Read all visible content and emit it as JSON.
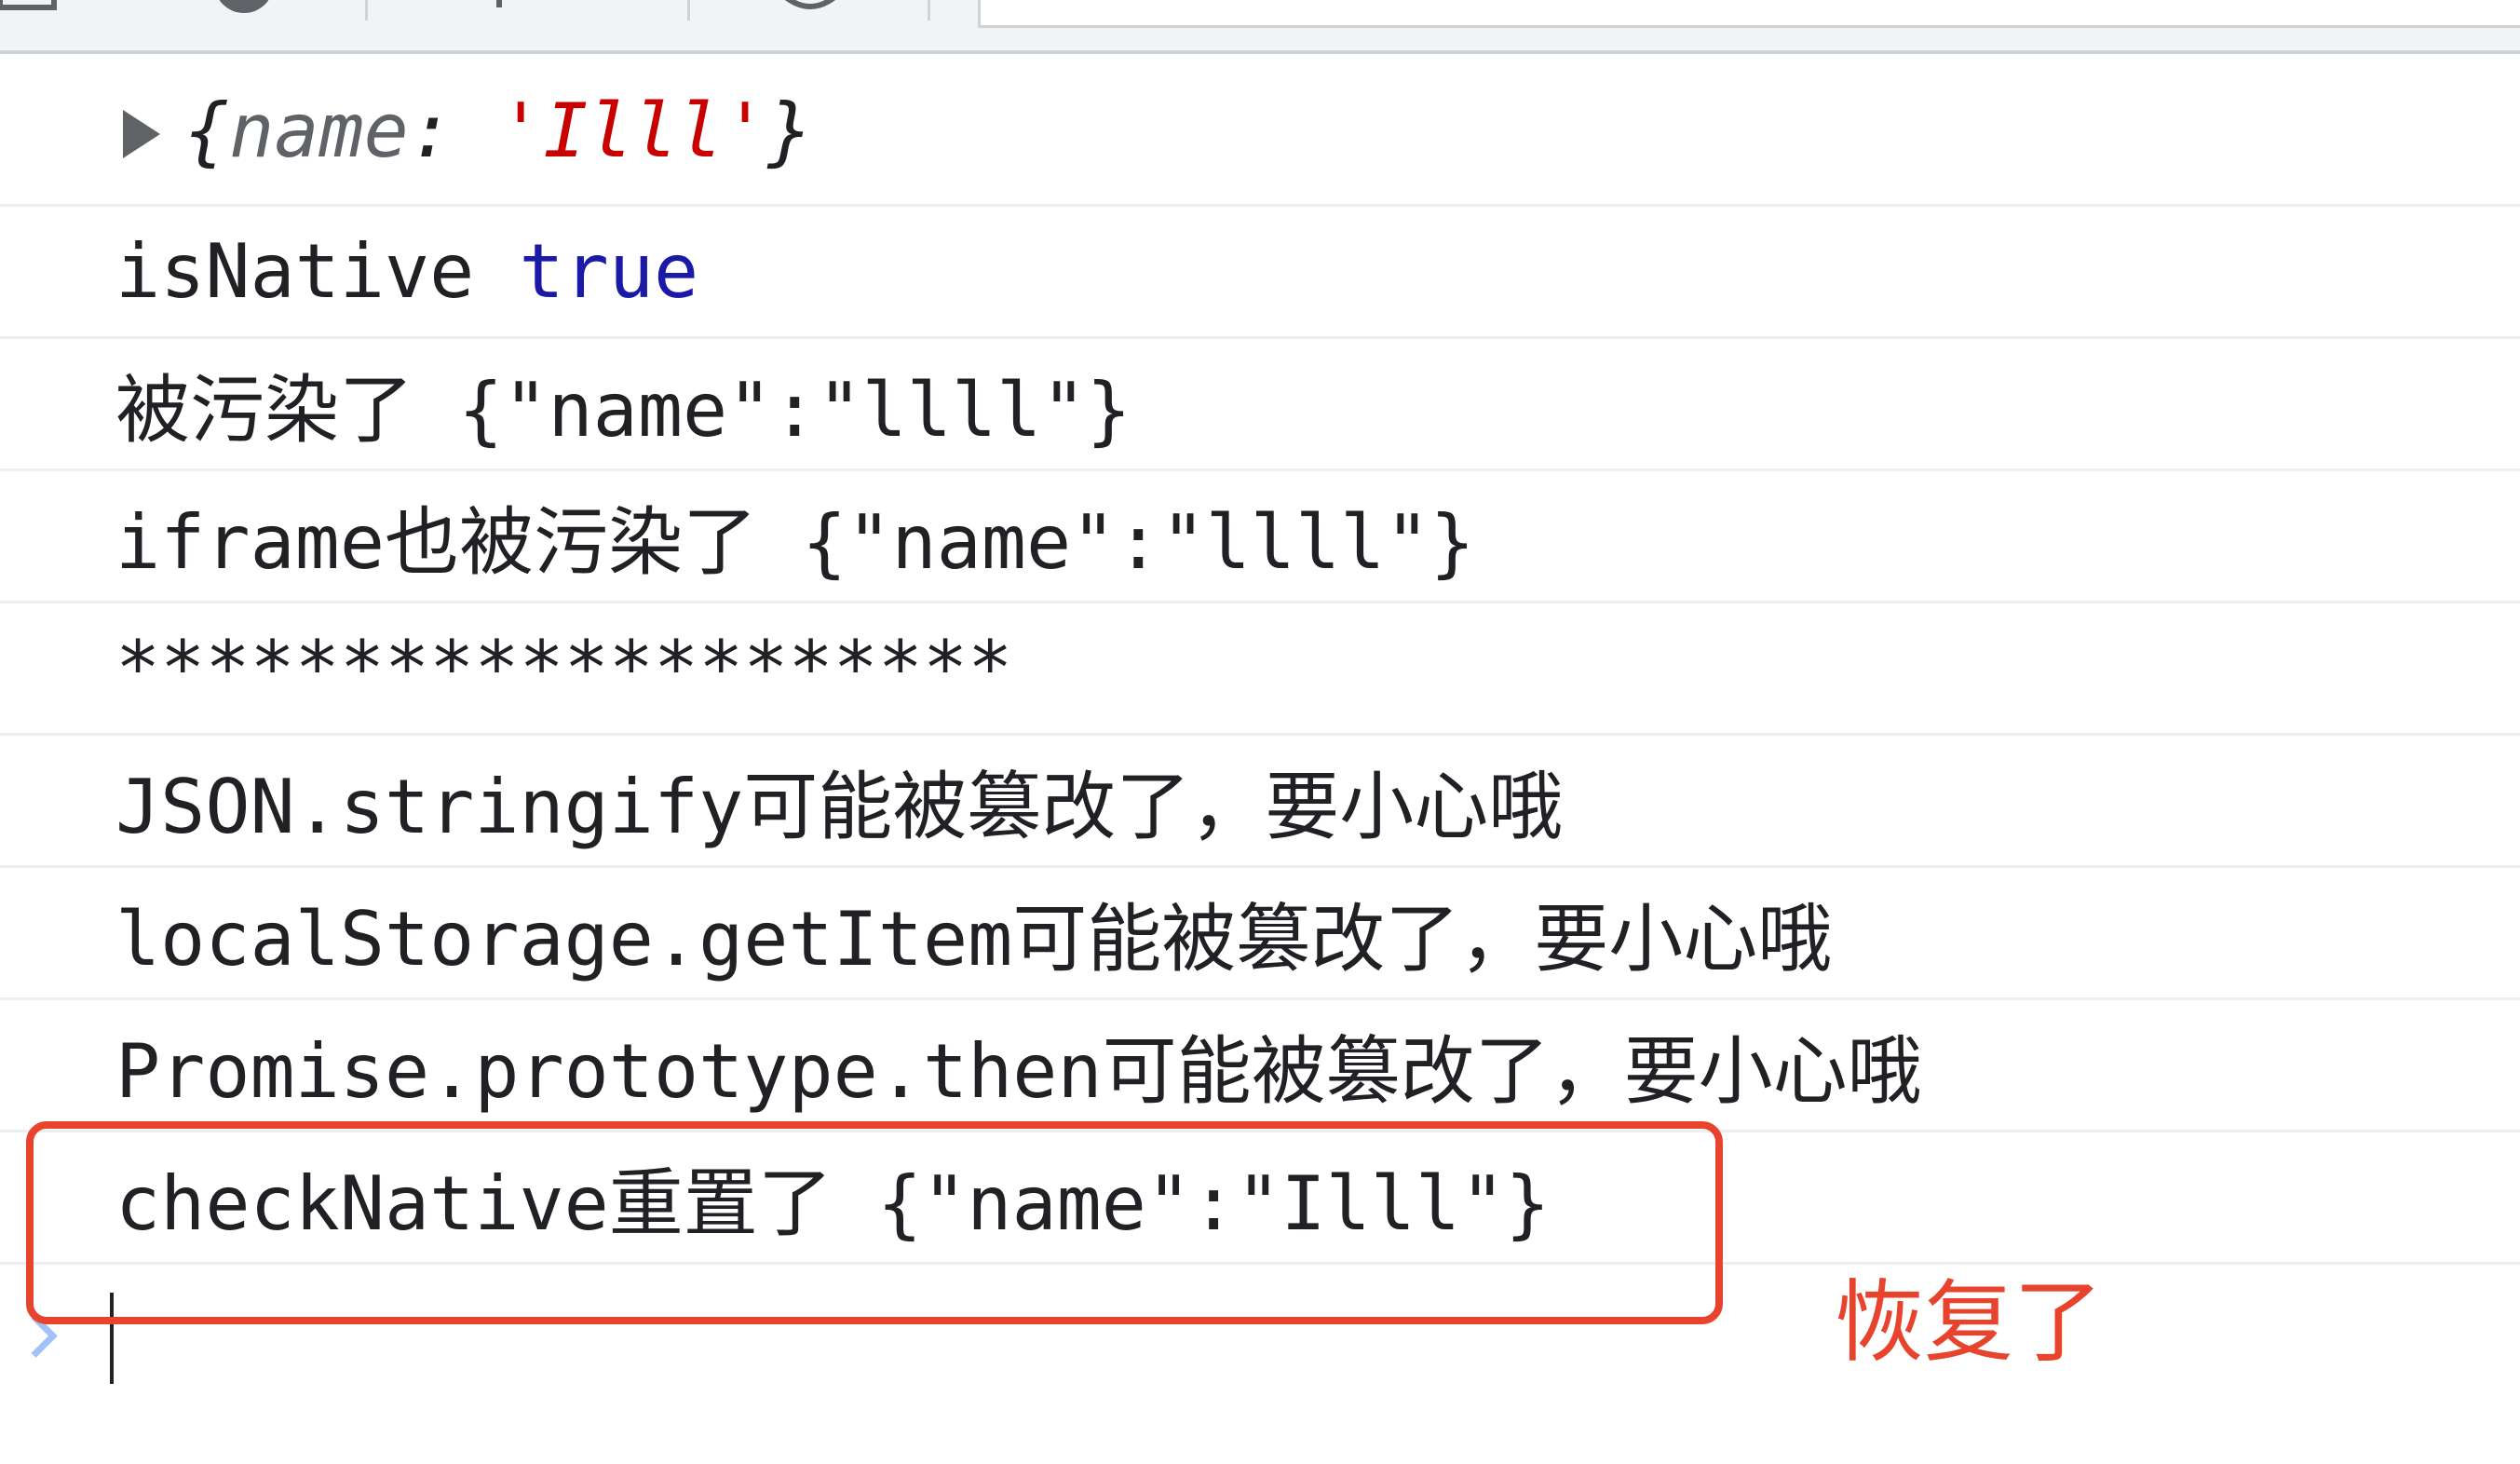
{
  "toolbar": {
    "icons": [
      "clear-console-icon",
      "block-icon",
      "context-dropdown-icon",
      "eye-icon"
    ],
    "filter_placeholder": ""
  },
  "console": {
    "rows": [
      {
        "kind": "object",
        "open": "{",
        "key": "name",
        "sep": ": ",
        "value": "'Illl'",
        "close": "}"
      },
      {
        "kind": "text",
        "label": "isNative",
        "value": "true"
      },
      {
        "kind": "text",
        "text": "被污染了 {\"name\":\"llll\"}"
      },
      {
        "kind": "text",
        "text": "iframe也被污染了 {\"name\":\"llll\"}"
      },
      {
        "kind": "text",
        "text": "********************"
      },
      {
        "kind": "text",
        "text": "JSON.stringify可能被篡改了，要小心哦"
      },
      {
        "kind": "text",
        "text": "localStorage.getItem可能被篡改了，要小心哦"
      },
      {
        "kind": "text",
        "text": "Promise.prototype.then可能被篡改了，要小心哦"
      },
      {
        "kind": "text",
        "text": "checkNative重置了 {\"name\":\"Illl\"}"
      }
    ]
  },
  "annotation": {
    "text": "恢复了",
    "color": "#e8432c"
  },
  "colors": {
    "keyword_true": "#1a1aa6",
    "string": "#c80000",
    "highlight": "#e8432c"
  }
}
